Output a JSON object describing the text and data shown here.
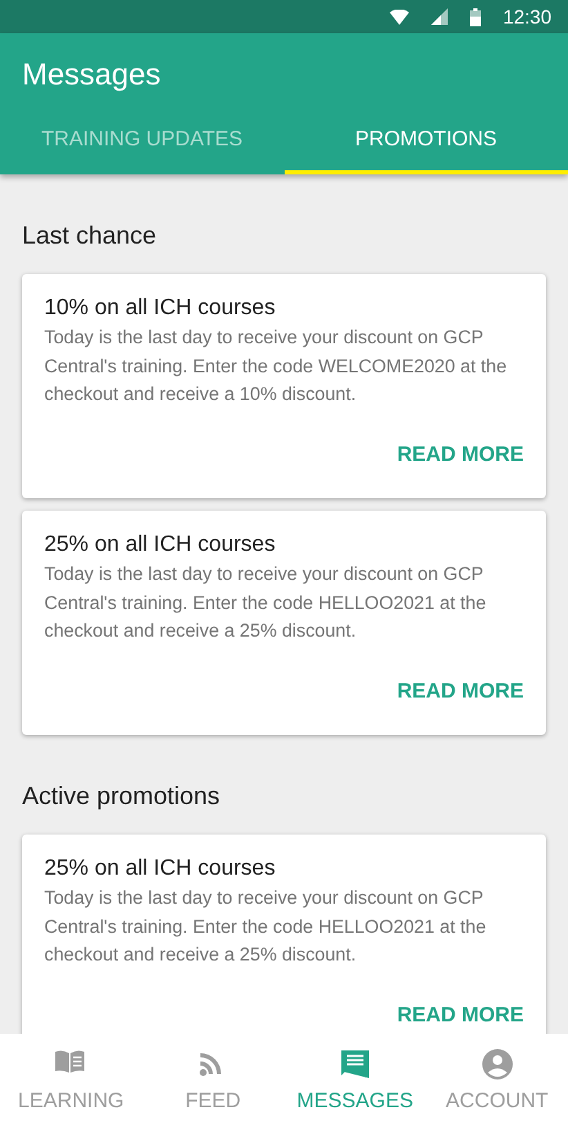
{
  "status_bar": {
    "time": "12:30"
  },
  "app_bar": {
    "title": "Messages"
  },
  "tabs": [
    {
      "label": "TRAINING UPDATES",
      "selected": false
    },
    {
      "label": "PROMOTIONS",
      "selected": true
    }
  ],
  "sections": [
    {
      "title": "Last chance",
      "cards": [
        {
          "title": "10% on all ICH courses",
          "body": "Today is the last day to receive your discount on GCP Central's training. Enter the code WELCOME2020 at the checkout and receive a 10% discount.",
          "action": "READ MORE"
        },
        {
          "title": "25% on all ICH courses",
          "body": "Today is the last day to receive your discount on GCP Central's training. Enter the code HELLOO2021 at the checkout and receive a 25% discount.",
          "action": "READ MORE"
        }
      ]
    },
    {
      "title": "Active promotions",
      "cards": [
        {
          "title": "25% on all ICH courses",
          "body": "Today is the last day to receive your discount on GCP Central's training. Enter the code HELLOO2021 at the checkout and receive a 25% discount.",
          "action": "READ MORE"
        }
      ]
    }
  ],
  "bottom_nav": [
    {
      "kind": "book",
      "label": "LEARNING",
      "selected": false
    },
    {
      "kind": "feed",
      "label": "FEED",
      "selected": false
    },
    {
      "kind": "message",
      "label": "MESSAGES",
      "selected": true
    },
    {
      "kind": "account",
      "label": "ACCOUNT",
      "selected": false
    }
  ]
}
